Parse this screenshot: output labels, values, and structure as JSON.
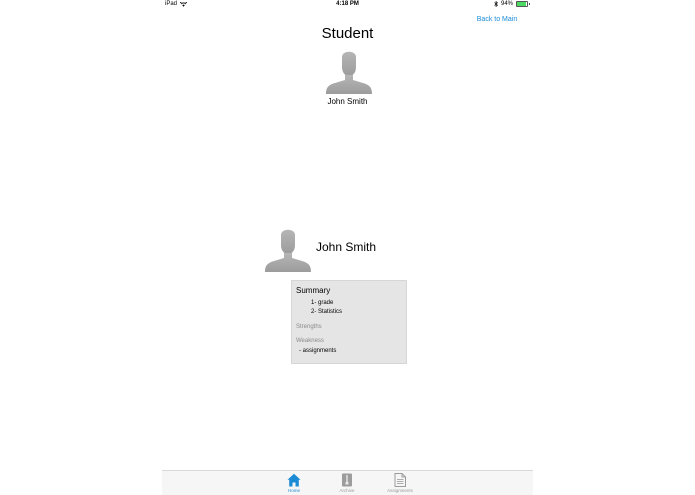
{
  "status_bar": {
    "device": "iPad",
    "time": "4:18 PM",
    "battery_text": "94%",
    "battery_level": 0.94,
    "icons": [
      "wifi-icon",
      "bluetooth-icon",
      "battery-icon"
    ]
  },
  "header": {
    "back_label": "Back to Main",
    "title": "Student",
    "name": "John Smith",
    "avatar_icon": "person-avatar-icon"
  },
  "profile": {
    "name": "John Smith",
    "avatar_icon": "person-avatar-icon"
  },
  "summary": {
    "title": "Summary",
    "items": [
      "1- grade",
      "2- Statistics"
    ],
    "strengths_label": "Strengths",
    "weakness_label": "Weakness",
    "weakness_items": [
      "- assignments"
    ]
  },
  "tabs": [
    {
      "label": "Home",
      "icon": "home-icon",
      "active": true
    },
    {
      "label": "Archive",
      "icon": "archive-icon",
      "active": false
    },
    {
      "label": "Assignments",
      "icon": "document-icon",
      "active": false
    }
  ],
  "colors": {
    "accent": "#1b8bd6",
    "panel_bg": "#e5e5e5",
    "muted_text": "#8a8a8a",
    "avatar": "#a8a8a8",
    "battery": "#4cd964"
  }
}
